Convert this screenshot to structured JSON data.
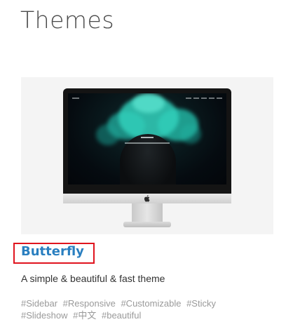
{
  "page": {
    "title": "Themes"
  },
  "theme": {
    "name": "Butterfly",
    "description": "A simple & beautiful & fast theme",
    "preview": {
      "screen_title": "JerryC"
    },
    "tags": [
      "#Sidebar",
      "#Responsive",
      "#Customizable",
      "#Sticky",
      "#Slideshow",
      "#中文",
      "#beautiful"
    ]
  },
  "colors": {
    "link": "#2a7fc0",
    "highlight_box": "#e0141e",
    "smoke": "#2bc4b0",
    "tag_text": "#9a9a9a"
  },
  "icons": {
    "apple_logo": "apple-logo-icon"
  }
}
